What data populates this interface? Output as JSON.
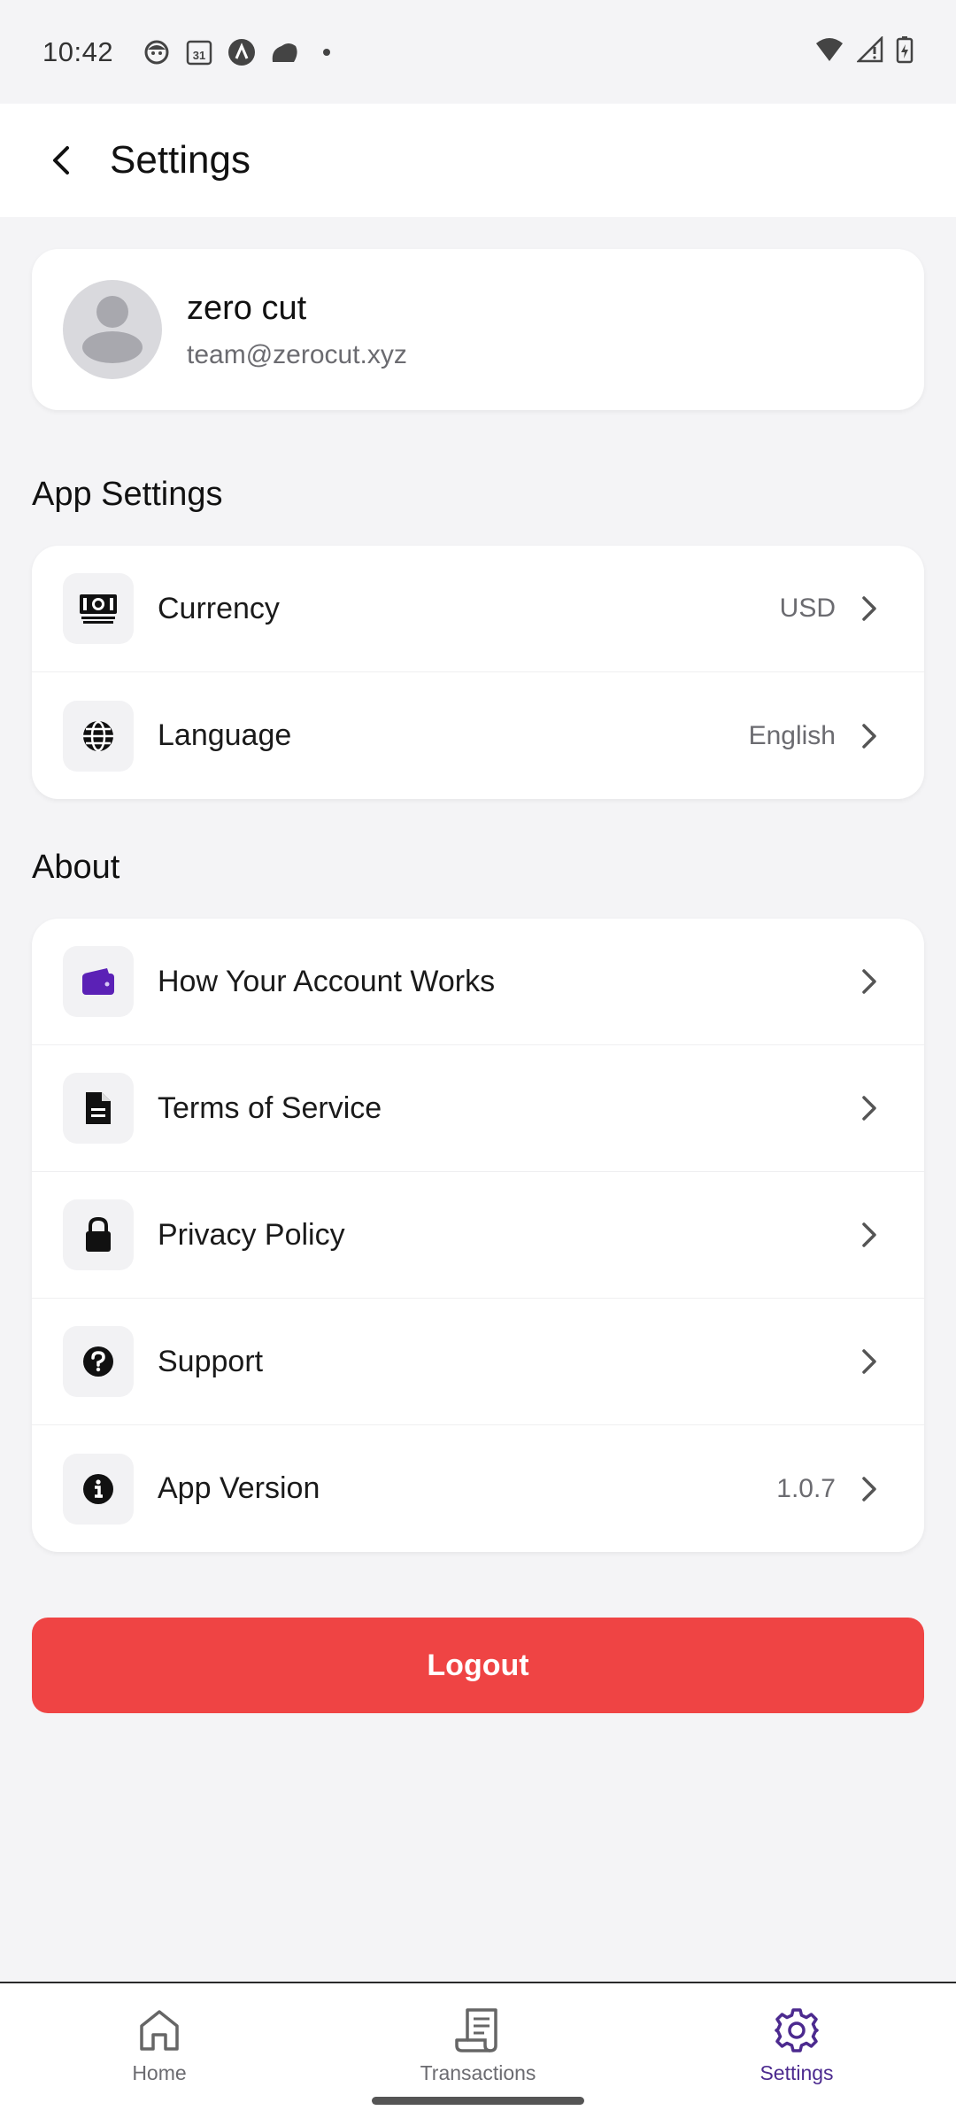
{
  "status_bar": {
    "time": "10:42",
    "left_icons": [
      "face-icon",
      "calendar-icon",
      "app-icon",
      "cloud-icon",
      "dot-icon"
    ],
    "calendar_day": "31",
    "right_icons": [
      "wifi-icon",
      "signal-icon",
      "battery-icon"
    ]
  },
  "header": {
    "title": "Settings"
  },
  "profile": {
    "name": "zero cut",
    "email": "team@zerocut.xyz"
  },
  "app_settings": {
    "title": "App Settings",
    "items": [
      {
        "label": "Currency",
        "value": "USD",
        "icon": "banknote-icon"
      },
      {
        "label": "Language",
        "value": "English",
        "icon": "globe-icon"
      }
    ]
  },
  "about": {
    "title": "About",
    "items": [
      {
        "label": "How Your Account Works",
        "value": "",
        "icon": "wallet-icon"
      },
      {
        "label": "Terms of Service",
        "value": "",
        "icon": "document-icon"
      },
      {
        "label": "Privacy Policy",
        "value": "",
        "icon": "lock-icon"
      },
      {
        "label": "Support",
        "value": "",
        "icon": "help-icon"
      },
      {
        "label": "App Version",
        "value": "1.0.7",
        "icon": "info-icon"
      }
    ]
  },
  "logout_label": "Logout",
  "nav": {
    "items": [
      {
        "label": "Home",
        "icon": "home-icon",
        "active": false
      },
      {
        "label": "Transactions",
        "icon": "receipt-icon",
        "active": false
      },
      {
        "label": "Settings",
        "icon": "gear-icon",
        "active": true
      }
    ]
  },
  "colors": {
    "accent": "#4c2a8f",
    "logout": "#ef4444",
    "background": "#f4f4f6",
    "card": "#ffffff"
  }
}
